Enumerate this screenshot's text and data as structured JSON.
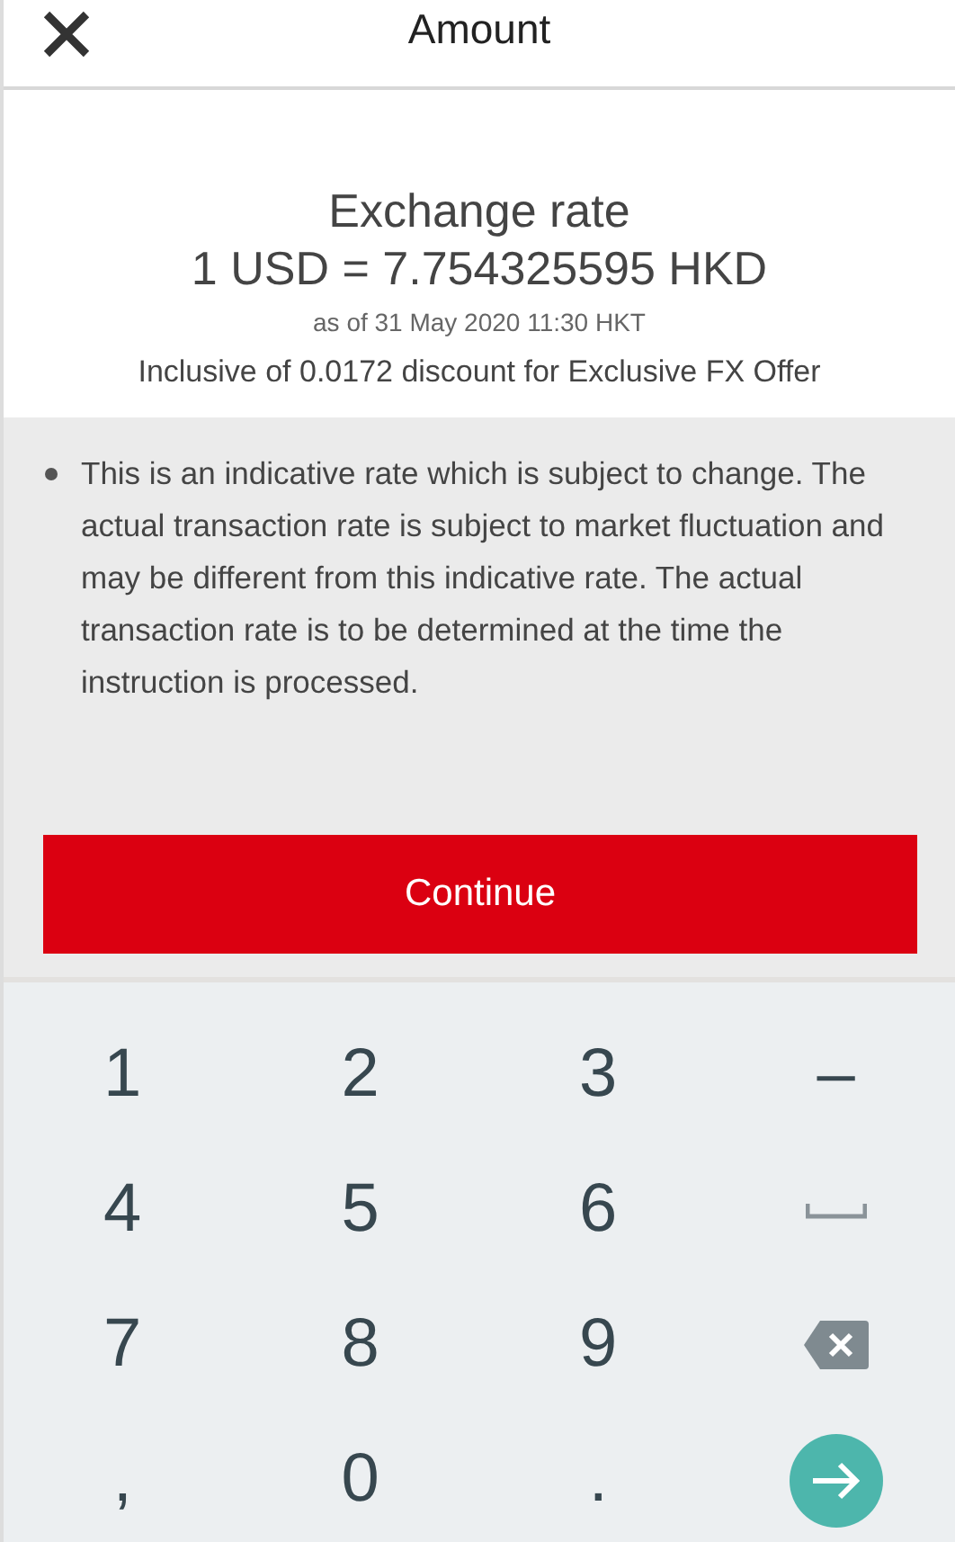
{
  "header": {
    "title": "Amount"
  },
  "rate": {
    "heading": "Exchange rate",
    "value": "1 USD = 7.754325595 HKD",
    "as_of": "as of 31 May 2020 11:30 HKT",
    "discount": "Inclusive of 0.0172 discount for Exclusive FX Offer"
  },
  "notes": [
    "This is an indicative rate which is subject to change. The actual transaction rate is subject to market fluctuation and may be different from this indicative rate. The actual transaction rate is to be determined at the time the instruction is processed."
  ],
  "continue_button": {
    "label": "Continue"
  },
  "keypad": [
    {
      "kind": "text",
      "label": "1"
    },
    {
      "kind": "text",
      "label": "2"
    },
    {
      "kind": "text",
      "label": "3"
    },
    {
      "kind": "text",
      "label": "–"
    },
    {
      "kind": "text",
      "label": "4"
    },
    {
      "kind": "text",
      "label": "5"
    },
    {
      "kind": "text",
      "label": "6"
    },
    {
      "kind": "space"
    },
    {
      "kind": "text",
      "label": "7"
    },
    {
      "kind": "text",
      "label": "8"
    },
    {
      "kind": "text",
      "label": "9"
    },
    {
      "kind": "backspace"
    },
    {
      "kind": "text",
      "label": ","
    },
    {
      "kind": "text",
      "label": "0"
    },
    {
      "kind": "text",
      "label": "."
    },
    {
      "kind": "enter"
    }
  ]
}
